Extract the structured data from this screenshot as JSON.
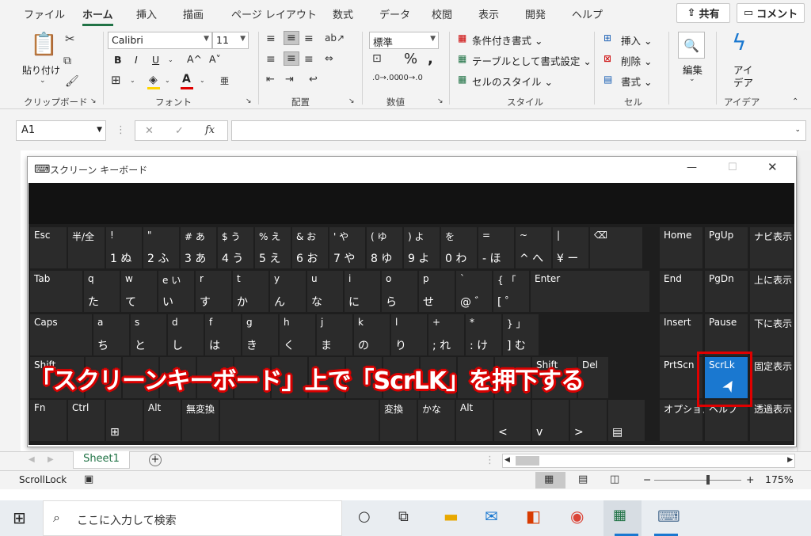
{
  "ribbon": {
    "tabs": [
      "ファイル",
      "ホーム",
      "挿入",
      "描画",
      "ページ レイアウト",
      "数式",
      "データ",
      "校閲",
      "表示",
      "開発",
      "ヘルプ"
    ],
    "share_label": "共有",
    "comment_label": "コメント",
    "clipboard": {
      "paste": "貼り付け",
      "label": "クリップボード"
    },
    "font": {
      "name": "Calibri",
      "size": "11",
      "label": "フォント",
      "bold": "B",
      "italic": "I",
      "underline": "U",
      "grow": "A^",
      "shrink": "A˅",
      "phonetic": "亜"
    },
    "alignment": {
      "label": "配置"
    },
    "number": {
      "format": "標準",
      "label": "数値",
      "percent": "%"
    },
    "styles": {
      "conditional": "条件付き書式",
      "table": "テーブルとして書式設定",
      "cell": "セルのスタイル",
      "label": "スタイル"
    },
    "cells": {
      "insert": "挿入",
      "delete": "削除",
      "format": "書式",
      "label": "セル"
    },
    "editing": {
      "label": "編集"
    },
    "ideas": {
      "label1": "アイ",
      "label2": "デア",
      "group": "アイデア"
    }
  },
  "formula_bar": {
    "name_box": "A1",
    "fx": "fx"
  },
  "osk": {
    "title": "スクリーン キーボード",
    "row1": [
      {
        "t": "Esc",
        "b": ""
      },
      {
        "t": "半/全",
        "b": ""
      },
      {
        "t": "!",
        "b": "1 ぬ"
      },
      {
        "t": "\"",
        "b": "2 ふ"
      },
      {
        "t": "# あ",
        "b": "3 あ"
      },
      {
        "t": "$ う",
        "b": "4 う"
      },
      {
        "t": "% え",
        "b": "5 え"
      },
      {
        "t": "& お",
        "b": "6 お"
      },
      {
        "t": "' や",
        "b": "7 や"
      },
      {
        "t": "( ゆ",
        "b": "8 ゆ"
      },
      {
        "t": ") よ",
        "b": "9 よ"
      },
      {
        "t": "を",
        "b": "0 わ"
      },
      {
        "t": "=",
        "b": "- ほ"
      },
      {
        "t": "~",
        "b": "^ へ"
      },
      {
        "t": "|",
        "b": "¥ ー"
      },
      {
        "t": "⌫",
        "b": ""
      }
    ],
    "row2": [
      {
        "t": "Tab",
        "b": ""
      },
      {
        "t": "q",
        "b": "た"
      },
      {
        "t": "w",
        "b": "て"
      },
      {
        "t": "e い",
        "b": "い"
      },
      {
        "t": "r",
        "b": "す"
      },
      {
        "t": "t",
        "b": "か"
      },
      {
        "t": "y",
        "b": "ん"
      },
      {
        "t": "u",
        "b": "な"
      },
      {
        "t": "i",
        "b": "に"
      },
      {
        "t": "o",
        "b": "ら"
      },
      {
        "t": "p",
        "b": "せ"
      },
      {
        "t": "`",
        "b": "@ ゛"
      },
      {
        "t": "{ 「",
        "b": "[ ゜"
      },
      {
        "t": "Enter",
        "b": ""
      }
    ],
    "row3": [
      {
        "t": "Caps",
        "b": ""
      },
      {
        "t": "a",
        "b": "ち"
      },
      {
        "t": "s",
        "b": "と"
      },
      {
        "t": "d",
        "b": "し"
      },
      {
        "t": "f",
        "b": "は"
      },
      {
        "t": "g",
        "b": "き"
      },
      {
        "t": "h",
        "b": "く"
      },
      {
        "t": "j",
        "b": "ま"
      },
      {
        "t": "k",
        "b": "の"
      },
      {
        "t": "l",
        "b": "り"
      },
      {
        "t": "+",
        "b": "; れ"
      },
      {
        "t": "*",
        "b": ": け"
      },
      {
        "t": "} 」",
        "b": "] む"
      }
    ],
    "row4": [
      {
        "t": "Shift",
        "b": ""
      },
      {
        "t": "",
        "b": ""
      },
      {
        "t": "",
        "b": ""
      },
      {
        "t": "",
        "b": ""
      },
      {
        "t": "",
        "b": ""
      },
      {
        "t": "",
        "b": ""
      },
      {
        "t": "",
        "b": ""
      },
      {
        "t": "",
        "b": ""
      },
      {
        "t": "",
        "b": ""
      },
      {
        "t": "",
        "b": ""
      },
      {
        "t": "",
        "b": ""
      },
      {
        "t": "",
        "b": ""
      },
      {
        "t": "",
        "b": ""
      },
      {
        "t": "Shift",
        "b": ""
      },
      {
        "t": "Del",
        "b": ""
      }
    ],
    "row5": [
      {
        "t": "Fn",
        "b": ""
      },
      {
        "t": "Ctrl",
        "b": ""
      },
      {
        "t": "",
        "b": "⊞"
      },
      {
        "t": "Alt",
        "b": ""
      },
      {
        "t": "無変換",
        "b": ""
      },
      {
        "t": "",
        "b": ""
      },
      {
        "t": "変換",
        "b": ""
      },
      {
        "t": "かな",
        "b": ""
      },
      {
        "t": "Alt",
        "b": ""
      },
      {
        "t": "",
        "b": "<"
      },
      {
        "t": "",
        "b": "v"
      },
      {
        "t": "",
        "b": ">"
      },
      {
        "t": "",
        "b": "▤"
      }
    ],
    "nav": [
      {
        "t": "Home"
      },
      {
        "t": "PgUp"
      },
      {
        "t": "ナビ表示"
      },
      {
        "t": "End"
      },
      {
        "t": "PgDn"
      },
      {
        "t": "上に表示"
      },
      {
        "t": "Insert"
      },
      {
        "t": "Pause"
      },
      {
        "t": "下に表示"
      },
      {
        "t": "PrtScn"
      },
      {
        "t": "ScrLk"
      },
      {
        "t": "固定表示"
      },
      {
        "t": "オプション"
      },
      {
        "t": "ヘルプ"
      },
      {
        "t": "透過表示"
      }
    ]
  },
  "annotation": "「スクリーンキーボード」上で「ScrLK」を押下する",
  "sheet": {
    "tab": "Sheet1",
    "add": "+"
  },
  "status": {
    "mode": "ScrollLock",
    "zoom": "175%",
    "minus": "−",
    "plus": "+"
  },
  "taskbar": {
    "search_placeholder": "ここに入力して検索"
  },
  "colors": {
    "excel_green": "#217346",
    "scrlk_blue": "#1a78d0",
    "highlight_red": "#e00000"
  }
}
